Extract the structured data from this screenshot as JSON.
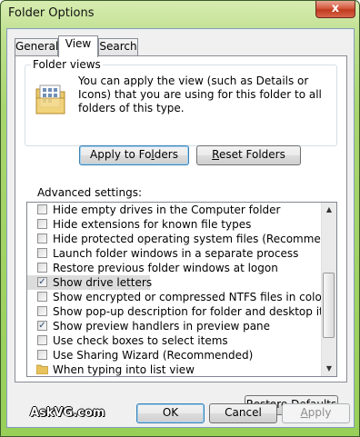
{
  "window": {
    "title": "Folder Options",
    "close_glyph": "x"
  },
  "tabs": [
    {
      "label": "General",
      "active": false
    },
    {
      "label": "View",
      "active": true
    },
    {
      "label": "Search",
      "active": false
    }
  ],
  "folder_views": {
    "legend": "Folder views",
    "description": "You can apply the view (such as Details or Icons) that you are using for this folder to all folders of this type.",
    "icon": "folder-grid-icon",
    "apply_pre": "Apply to Fo",
    "apply_key": "l",
    "apply_post": "ders",
    "reset_key": "R",
    "reset_post": "eset Folders"
  },
  "advanced": {
    "label": "Advanced settings:",
    "items": [
      {
        "label": "Hide empty drives in the Computer folder",
        "checked": false,
        "type": "checkbox"
      },
      {
        "label": "Hide extensions for known file types",
        "checked": false,
        "type": "checkbox"
      },
      {
        "label": "Hide protected operating system files (Recommended)",
        "checked": false,
        "type": "checkbox"
      },
      {
        "label": "Launch folder windows in a separate process",
        "checked": false,
        "type": "checkbox"
      },
      {
        "label": "Restore previous folder windows at logon",
        "checked": false,
        "type": "checkbox"
      },
      {
        "label": "Show drive letters",
        "checked": true,
        "type": "checkbox",
        "selected": true
      },
      {
        "label": "Show encrypted or compressed NTFS files in color",
        "checked": false,
        "type": "checkbox"
      },
      {
        "label": "Show pop-up description for folder and desktop items",
        "checked": false,
        "type": "checkbox"
      },
      {
        "label": "Show preview handlers in preview pane",
        "checked": true,
        "type": "checkbox"
      },
      {
        "label": "Use check boxes to select items",
        "checked": false,
        "type": "checkbox"
      },
      {
        "label": "Use Sharing Wizard (Recommended)",
        "checked": false,
        "type": "checkbox"
      },
      {
        "label": "When typing into list view",
        "type": "folder"
      }
    ],
    "scroll_up_glyph": "▲",
    "scroll_down_glyph": "▼"
  },
  "restore_defaults": {
    "pre": "Restore ",
    "key": "D",
    "post": "efaults"
  },
  "footer": {
    "ok_label": "OK",
    "cancel_label": "Cancel",
    "apply_key": "A",
    "apply_post": "pply"
  },
  "watermark": "AskVG.com",
  "colors": {
    "accent": "#98cf58",
    "selection": "#dcdcdc",
    "close_button": "#c03b1e"
  }
}
